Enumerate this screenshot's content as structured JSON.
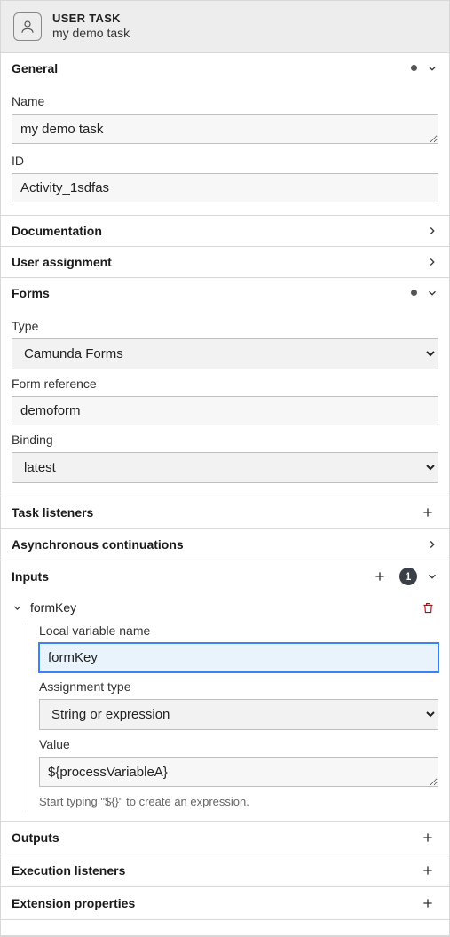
{
  "header": {
    "type_label": "USER TASK",
    "name": "my demo task"
  },
  "general": {
    "title": "General",
    "name_label": "Name",
    "name_value": "my demo task",
    "id_label": "ID",
    "id_value": "Activity_1sdfas"
  },
  "documentation": {
    "title": "Documentation"
  },
  "user_assignment": {
    "title": "User assignment"
  },
  "forms": {
    "title": "Forms",
    "type_label": "Type",
    "type_value": "Camunda Forms",
    "formref_label": "Form reference",
    "formref_value": "demoform",
    "binding_label": "Binding",
    "binding_value": "latest"
  },
  "task_listeners": {
    "title": "Task listeners"
  },
  "async_cont": {
    "title": "Asynchronous continuations"
  },
  "inputs": {
    "title": "Inputs",
    "count": "1",
    "item": {
      "name": "formKey",
      "localvar_label": "Local variable name",
      "localvar_value": "formKey",
      "assign_label": "Assignment type",
      "assign_value": "String or expression",
      "value_label": "Value",
      "value_value": "${processVariableA}",
      "hint": "Start typing \"${}\" to create an expression."
    }
  },
  "outputs": {
    "title": "Outputs"
  },
  "exec_listeners": {
    "title": "Execution listeners"
  },
  "ext_props": {
    "title": "Extension properties"
  }
}
